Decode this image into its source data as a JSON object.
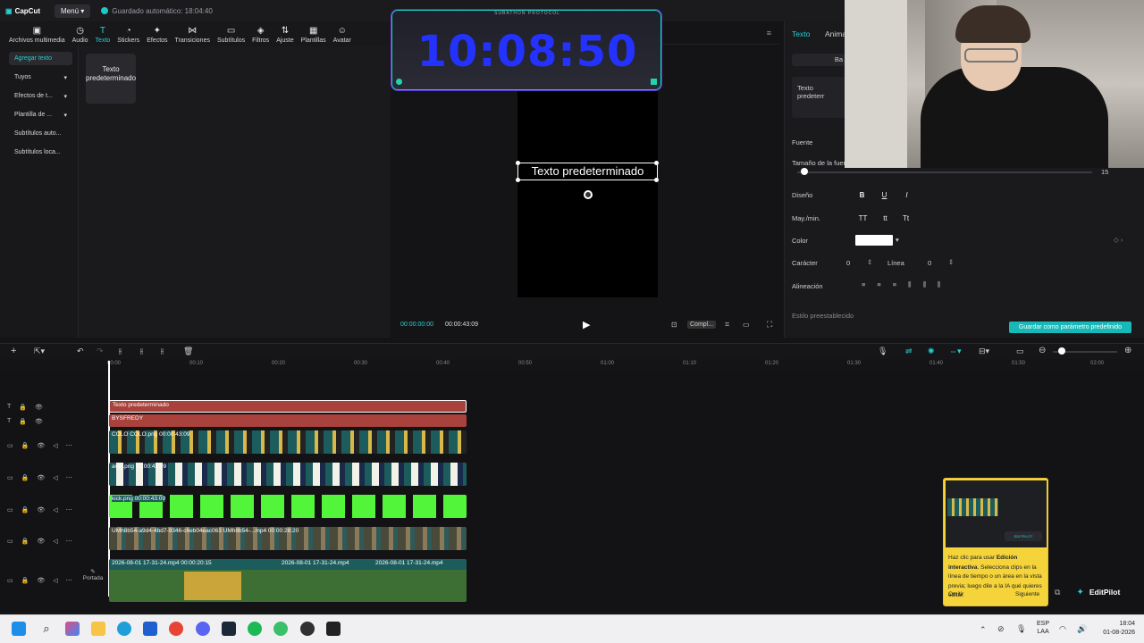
{
  "app": {
    "logo": "CapCut",
    "menu": "Menú",
    "autosave": "Guardado automático: 18:04:40"
  },
  "toolbar": {
    "items": [
      "Archivos multimedia",
      "Audio",
      "Texto",
      "Stickers",
      "Efectos",
      "Transiciones",
      "Subtítulos",
      "Filtros",
      "Ajuste",
      "Plantillas",
      "Avatar"
    ],
    "active": "Texto"
  },
  "leftnav": {
    "items": [
      "Agregar texto",
      "Tuyos",
      "Efectos de t...",
      "Plantilla de ...",
      "Subtítulos auto...",
      "Subtítulos loca..."
    ]
  },
  "text_card": {
    "label": "Texto predeterminado"
  },
  "clock": {
    "time": "10:08:50",
    "label": "SUBATHON PROTOCOL"
  },
  "player": {
    "text": "Texto predeterminado",
    "current": "00:00:00:00",
    "total": "00:00:43:09",
    "ratio": "Compl..."
  },
  "right": {
    "tabs": [
      "Texto",
      "Anima"
    ],
    "basic_btn": "Ba",
    "text_value": "Texto predeterr",
    "font_label": "Fuente",
    "size_label": "Tamaño de la fuen",
    "size_value": "15",
    "design_label": "Diseño",
    "case_label": "May./min.",
    "color_label": "Color",
    "char_label": "Carácter",
    "char_value": "0",
    "line_label": "Línea",
    "line_value": "0",
    "align_label": "Alineación",
    "preset_label": "Estilo preestablecido",
    "save_preset": "Guardar como parámetro predefinido",
    "colors": {
      "text_color": "#ffffff"
    }
  },
  "ruler": [
    "00:00",
    "00:10",
    "00:20",
    "00:30",
    "00:40",
    "00:50",
    "01:00",
    "01:10",
    "01:20",
    "01:30",
    "01:40",
    "01:50",
    "02:00"
  ],
  "tracks": {
    "text1": "Texto predeterminado",
    "text2": "BYSFREDY",
    "v1": "COLO COLO.png  00:00:43:09",
    "v2": "aver.png  00:00:43:09",
    "v3": "kick.png  00:00:43:09",
    "v4": "UMh8b54-a9d4-4bd7-9346-c6eb04eac063  UMh8b54-...mp4  00:00:28:20",
    "main_a": "2026-08-01 17-31-24.mp4  00:00:20:15",
    "main_b": "2026-08-01 17-31-24.mp4",
    "main_c": "2026-08-01 17-31-24.mp4",
    "cover": "Portada"
  },
  "tip": {
    "text_a": "Haz clic para usar ",
    "bold_a": "Edición interactiva",
    "text_b": ". Selecciona clips en la línea de tiempo o un área en la vista previa; luego dile a la IA qué quieres editar.",
    "btn_a": "Omitir",
    "btn_b": "Siguiente",
    "badge": "EDITPILOT"
  },
  "editpilot": "EditPilot",
  "taskbar": {
    "lang": "ESP",
    "lang2": "LAA",
    "time": "18:04",
    "date": "01-08-2026"
  }
}
